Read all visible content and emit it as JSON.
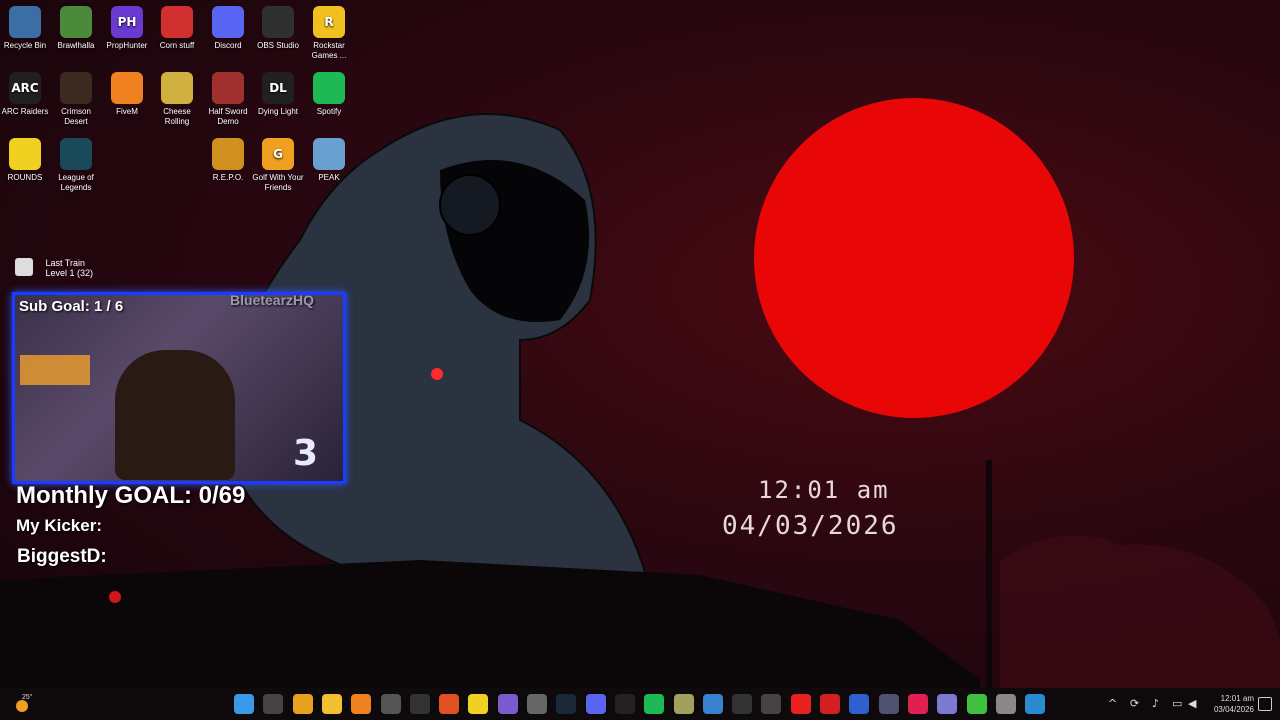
{
  "desktop": {
    "icons": [
      {
        "label": "Recycle Bin",
        "icon": "recycle-bin-icon",
        "color": "#3a6ea5"
      },
      {
        "label": "Brawlhalla",
        "icon": "brawlhalla-icon",
        "color": "#4a8a3a"
      },
      {
        "label": "PropHunter",
        "icon": "prophunter-icon",
        "color": "#6a3ad0",
        "glyph": "PH"
      },
      {
        "label": "Corn stuff",
        "icon": "corn-stuff-icon",
        "color": "#d03030"
      },
      {
        "label": "Discord",
        "icon": "discord-icon",
        "color": "#5865f2"
      },
      {
        "label": "OBS Studio",
        "icon": "obs-studio-icon",
        "color": "#303030"
      },
      {
        "label": "Rockstar Games ...",
        "icon": "rockstar-icon",
        "color": "#f0c020",
        "glyph": "R"
      },
      {
        "label": "ARC Raiders",
        "icon": "arc-raiders-icon",
        "color": "#202020",
        "glyph": "ARC"
      },
      {
        "label": "Crimson Desert",
        "icon": "crimson-desert-icon",
        "color": "#3a2a20"
      },
      {
        "label": "FiveM",
        "icon": "fivem-icon",
        "color": "#f08020"
      },
      {
        "label": "Cheese Rolling",
        "icon": "cheese-rolling-icon",
        "color": "#d0b040"
      },
      {
        "label": "Half Sword Demo",
        "icon": "half-sword-icon",
        "color": "#a03030"
      },
      {
        "label": "Dying Light",
        "icon": "dying-light-icon",
        "color": "#202020",
        "glyph": "DL"
      },
      {
        "label": "Spotify",
        "icon": "spotify-icon",
        "color": "#1db954"
      },
      {
        "label": "ROUNDS",
        "icon": "rounds-icon",
        "color": "#f0d020"
      },
      {
        "label": "League of Legends",
        "icon": "league-of-legends-icon",
        "color": "#1a4a5a"
      },
      {
        "label": "R.E.P.O.",
        "icon": "repo-icon",
        "color": "#d09020"
      },
      {
        "label": "Golf With Your Friends",
        "icon": "golf-with-your-friends-icon",
        "color": "#f0a020",
        "glyph": "G"
      },
      {
        "label": "PEAK",
        "icon": "peak-icon",
        "color": "#6aa0d0"
      }
    ]
  },
  "overlay": {
    "last_train_title": "Last Train",
    "last_train_level": "Level 1  (32)",
    "sub_goal": "Sub Goal:  1 / 6",
    "channel": "BluetearzHQ",
    "monthly_goal": "Monthly GOAL: 0/69",
    "my_kicker": "My Kicker:",
    "biggest": "BiggestD:"
  },
  "clock": {
    "time": "12:01 am",
    "date": "04/03/2026"
  },
  "taskbar": {
    "weather": "25°",
    "tray_time": "12:01 am",
    "tray_date": "03/04/2026",
    "apps": [
      "start-icon",
      "search-icon",
      "chrome-icon",
      "file-explorer-icon",
      "vlc-icon",
      "obs-icon",
      "epic-games-icon",
      "brave-icon",
      "sticky-notes-icon",
      "app-icon-1",
      "app-icon-2",
      "steam-icon",
      "discord-icon",
      "capcut-icon",
      "spotify-icon",
      "app-icon-3",
      "photos-icon",
      "terminal-icon",
      "app-icon-4",
      "faceit-icon",
      "app-icon-5",
      "app-icon-6",
      "app-icon-7",
      "tiktok-icon",
      "app-icon-8",
      "app-icon-9",
      "settings-icon",
      "app-icon-10"
    ]
  }
}
